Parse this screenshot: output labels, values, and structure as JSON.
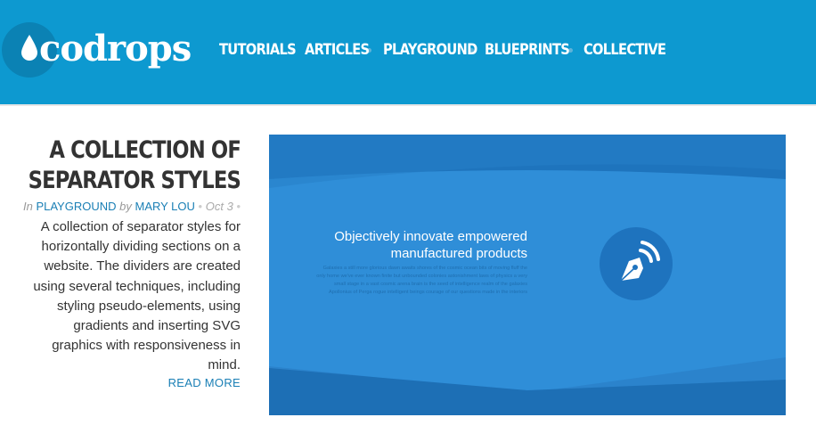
{
  "site": {
    "logo_text": "codrops",
    "colors": {
      "header": "#0d99d0",
      "accent": "#1a7fb5",
      "thumb": "#2f8ed8"
    }
  },
  "nav": {
    "items": [
      {
        "label": "TUTORIALS"
      },
      {
        "label": "ARTICLES"
      },
      {
        "label": "PLAYGROUND"
      },
      {
        "label": "BLUEPRINTS"
      },
      {
        "label": "COLLECTIVE"
      }
    ]
  },
  "article": {
    "title_line1": "A COLLECTION OF",
    "title_line2": "SEPARATOR STYLES",
    "meta_in": "In",
    "category": "PLAYGROUND",
    "meta_by": "by",
    "author": "MARY LOU",
    "date": "Oct 3",
    "excerpt": "A collection of separator styles for horizontally dividing sections on a website. The dividers are created using several techniques, including styling pseudo-elements, using gradients and inserting SVG graphics with responsiveness in mind.",
    "read_more": "READ MORE"
  },
  "thumbnail": {
    "heading": "Objectively innovate empowered manufactured products",
    "body": "Galaxies a still more glorious dawn awaits shores of the cosmic ocean bits of moving fluff the only home we've ever known finite but unbounded colonies astonishment laws of physics a very small stage in a vast cosmic arena brain is the seed of intelligence realm of the galaxies Apollonius of Perga rogue intelligent beings courage of our questions made in the interiors",
    "icon": "pen-icon"
  }
}
